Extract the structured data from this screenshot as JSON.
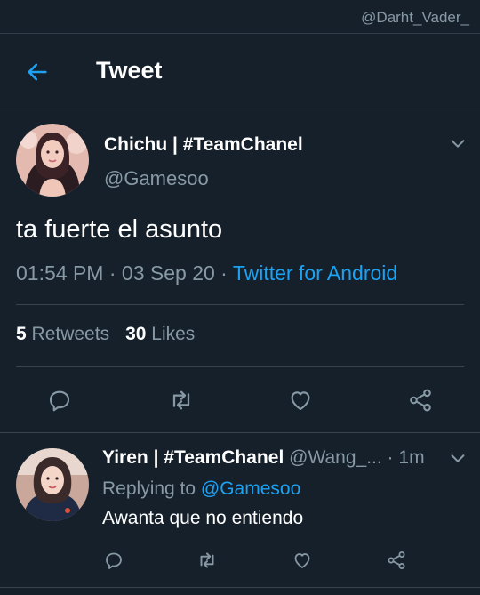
{
  "watermark": "@Darht_Vader_",
  "header": {
    "title": "Tweet",
    "back_icon": "arrow-left-icon"
  },
  "colors": {
    "background": "#15202b",
    "accent": "#1da1f2",
    "muted": "#8899a6",
    "divider": "#38444d"
  },
  "tweet": {
    "author_name": "Chichu | #TeamChanel",
    "author_handle": "@Gamesoo",
    "text": "ta fuerte el asunto",
    "time": "01:54 PM",
    "date": "03 Sep 20",
    "source": "Twitter for Android",
    "retweets_count": "5",
    "retweets_label": "Retweets",
    "likes_count": "30",
    "likes_label": "Likes",
    "actions": [
      "reply-icon",
      "retweet-icon",
      "like-icon",
      "share-icon"
    ]
  },
  "reply": {
    "author_name": "Yiren | #TeamChanel",
    "author_handle": "@Wang_...",
    "time": "1m",
    "replying_label": "Replying to",
    "replying_to": "@Gamesoo",
    "text": "Awanta que no entiendo",
    "actions": [
      "reply-icon",
      "retweet-icon",
      "like-icon",
      "share-icon"
    ]
  }
}
